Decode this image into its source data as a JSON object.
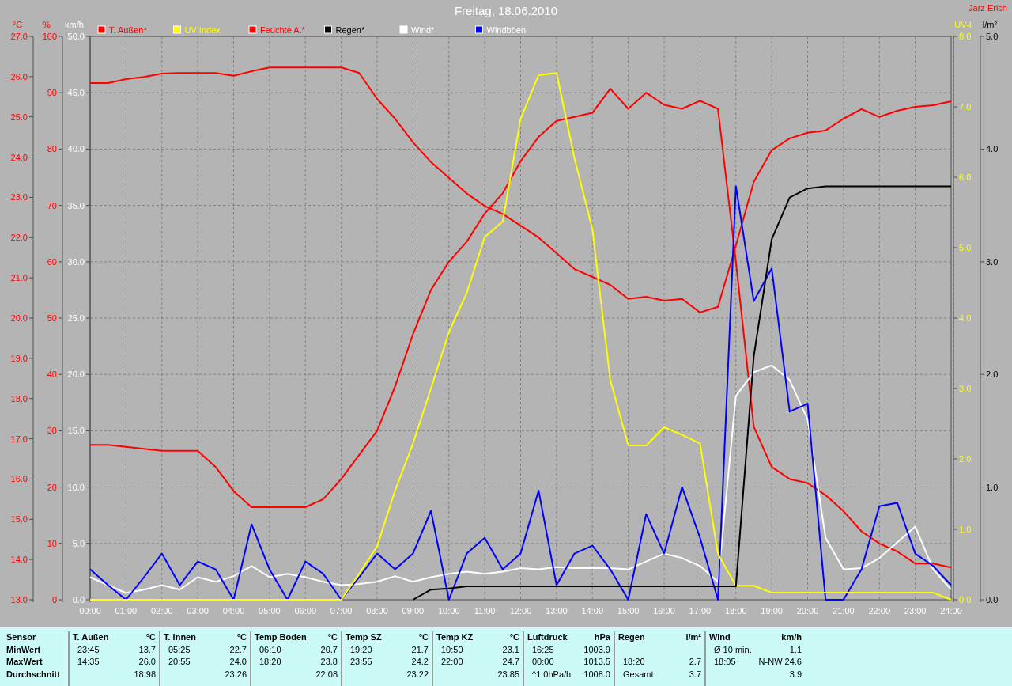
{
  "chart": {
    "author": "Jarz Erich",
    "left_scale": {
      "chart_data": {
        "type": "line",
        "title": "Freitag, 18.06.2010",
        "legend": "top",
        "grid": true,
        "x": [
          0,
          0.5,
          1,
          1.5,
          2,
          2.5,
          3,
          3.5,
          4,
          4.5,
          5,
          5.5,
          6,
          6.5,
          7,
          7.5,
          8,
          8.5,
          9,
          9.5,
          10,
          10.5,
          11,
          11.5,
          12,
          12.5,
          13,
          13.5,
          14,
          14.5,
          15,
          15.5,
          16,
          16.5,
          17,
          17.5,
          18,
          18.5,
          19,
          19.5,
          20,
          20.5,
          21,
          21.5,
          22,
          22.5,
          23,
          23.5,
          24
        ],
        "xlim": [
          0,
          24
        ],
        "xticks": [
          {
            "value": 0,
            "label": "00:00"
          },
          {
            "value": 1,
            "label": "01:00"
          },
          {
            "value": 2,
            "label": "02:00"
          },
          {
            "value": 3,
            "label": "03:00"
          },
          {
            "value": 4,
            "label": "04:00"
          },
          {
            "value": 5,
            "label": "05:00"
          },
          {
            "value": 6,
            "label": "06:00"
          },
          {
            "value": 7,
            "label": "07:00"
          },
          {
            "value": 8,
            "label": "08:00"
          },
          {
            "value": 9,
            "label": "09:00"
          },
          {
            "value": 10,
            "label": "10:00"
          },
          {
            "value": 11,
            "label": "11:00"
          },
          {
            "value": 12,
            "label": "12:00"
          },
          {
            "value": 13,
            "label": "13:00"
          },
          {
            "value": 14,
            "label": "14:00"
          },
          {
            "value": 15,
            "label": "15:00"
          },
          {
            "value": 16,
            "label": "16:00"
          },
          {
            "value": 17,
            "label": "17:00"
          },
          {
            "value": 18,
            "label": "18:00"
          },
          {
            "value": 19,
            "label": "19:00"
          },
          {
            "value": 20,
            "label": "20:00"
          },
          {
            "value": 21,
            "label": "21:00"
          },
          {
            "value": 22,
            "label": "22:00"
          },
          {
            "value": 23,
            "label": "23:00"
          },
          {
            "value": 24,
            "label": "24:00"
          }
        ],
        "ylabel": "km/h",
        "ylim": [
          0,
          50
        ],
        "yticks": [
          {
            "value": 50,
            "label": "50.0"
          },
          {
            "value": 45,
            "label": "45.0"
          },
          {
            "value": 40,
            "label": "40.0"
          },
          {
            "value": 35,
            "label": "35.0"
          },
          {
            "value": 30,
            "label": "30.0"
          },
          {
            "value": 25,
            "label": "25.0"
          },
          {
            "value": 20,
            "label": "20.0"
          },
          {
            "value": 15,
            "label": "15.0"
          },
          {
            "value": 10,
            "label": "10.0"
          },
          {
            "value": 5,
            "label": "5.0"
          },
          {
            "value": 0,
            "label": "0.0"
          }
        ],
        "y2label": "°C",
        "y2lim": [
          13,
          27
        ],
        "y2ticks": [
          {
            "value": 27,
            "label": "27.0"
          },
          {
            "value": 26,
            "label": "26.0"
          },
          {
            "value": 25,
            "label": "25.0"
          },
          {
            "value": 24,
            "label": "24.0"
          },
          {
            "value": 23,
            "label": "23.0"
          },
          {
            "value": 22,
            "label": "22.0"
          },
          {
            "value": 21,
            "label": "21.0"
          },
          {
            "value": 20,
            "label": "20.0"
          },
          {
            "value": 19,
            "label": "19.0"
          },
          {
            "value": 18,
            "label": "18.0"
          },
          {
            "value": 17,
            "label": "17.0"
          },
          {
            "value": 16,
            "label": "16.0"
          },
          {
            "value": 15,
            "label": "15.0"
          },
          {
            "value": 14,
            "label": "14.0"
          },
          {
            "value": 13,
            "label": "13.0"
          }
        ],
        "y3label": "%",
        "y3lim": [
          0,
          100
        ],
        "y3ticks": [
          {
            "value": 100,
            "label": "100"
          },
          {
            "value": 90,
            "label": "90"
          },
          {
            "value": 80,
            "label": "80"
          },
          {
            "value": 70,
            "label": "70"
          },
          {
            "value": 60,
            "label": "60"
          },
          {
            "value": 50,
            "label": "50"
          },
          {
            "value": 40,
            "label": "40"
          },
          {
            "value": 30,
            "label": "30"
          },
          {
            "value": 20,
            "label": "20"
          },
          {
            "value": 10,
            "label": "10"
          },
          {
            "value": 0,
            "label": "0"
          }
        ],
        "series": [
          {
            "name": "T. Außen*",
            "color": "#ff0000",
            "axis": "y2",
            "values": [
              16.85,
              16.85,
              16.8,
              16.75,
              16.7,
              16.7,
              16.7,
              16.3,
              15.7,
              15.3,
              15.3,
              15.3,
              15.3,
              15.5,
              16.0,
              16.6,
              17.2,
              18.3,
              19.6,
              20.7,
              21.4,
              21.9,
              22.6,
              23.1,
              23.9,
              24.5,
              24.9,
              25.0,
              25.1,
              25.7,
              25.2,
              25.6,
              25.3,
              25.2,
              25.4,
              25.2,
              21.4,
              17.3,
              16.3,
              16.0,
              15.9,
              15.6,
              15.2,
              14.7,
              14.4,
              14.2,
              13.9,
              13.9,
              13.8
            ]
          },
          {
            "name": "Feuchte A.*",
            "color": "#ff0000",
            "axis": "y3",
            "values": [
              91.7,
              91.7,
              92.4,
              92.8,
              93.4,
              93.5,
              93.5,
              93.5,
              93.0,
              93.8,
              94.5,
              94.5,
              94.5,
              94.5,
              94.5,
              93.5,
              88.9,
              85.4,
              81.2,
              77.7,
              74.9,
              72.1,
              69.9,
              68.5,
              66.4,
              64.3,
              61.5,
              58.7,
              57.3,
              55.9,
              53.4,
              53.8,
              53.1,
              53.4,
              51.0,
              52.0,
              62.9,
              74.2,
              79.8,
              81.9,
              82.9,
              83.3,
              85.4,
              87.1,
              85.7,
              86.8,
              87.5,
              87.8,
              88.5
            ]
          },
          {
            "name": "Wind*",
            "color": "#ffffff",
            "values": [
              2.0,
              1.3,
              0.6,
              0.9,
              1.3,
              0.9,
              2.0,
              1.6,
              2.1,
              3.0,
              2.0,
              2.3,
              2.0,
              1.6,
              1.3,
              1.4,
              1.6,
              2.1,
              1.6,
              2.0,
              2.3,
              2.5,
              2.3,
              2.5,
              2.8,
              2.7,
              2.9,
              2.8,
              2.8,
              2.8,
              2.7,
              3.4,
              4.1,
              3.7,
              3.0,
              1.6,
              18.1,
              20.2,
              20.8,
              19.5,
              16.0,
              5.5,
              2.7,
              2.8,
              3.7,
              5.1,
              6.5,
              2.7,
              0.9
            ]
          },
          {
            "name": "Windböen",
            "color": "#0000ff",
            "values": [
              2.7,
              1.3,
              0,
              2.0,
              4.1,
              1.3,
              3.4,
              2.7,
              0,
              6.7,
              2.7,
              0,
              3.4,
              2.3,
              0,
              2.0,
              4.1,
              2.7,
              4.1,
              7.9,
              0,
              4.1,
              5.5,
              2.7,
              4.1,
              9.7,
              1.3,
              4.1,
              4.8,
              2.7,
              0,
              7.6,
              4.1,
              10.0,
              5.5,
              0,
              36.7,
              26.5,
              29.4,
              16.7,
              17.4,
              0,
              0,
              2.7,
              8.3,
              8.6,
              4.1,
              3.0,
              1.3
            ]
          }
        ]
      }
    },
    "right_scale": {
      "chart_data": {
        "type": "line",
        "legend": "top",
        "x": [
          0,
          0.5,
          1,
          1.5,
          2,
          2.5,
          3,
          3.5,
          4,
          4.5,
          5,
          5.5,
          6,
          6.5,
          7,
          7.5,
          8,
          8.5,
          9,
          9.5,
          10,
          10.5,
          11,
          11.5,
          12,
          12.5,
          13,
          13.5,
          14,
          14.5,
          15,
          15.5,
          16,
          16.5,
          17,
          17.5,
          18,
          18.5,
          19,
          19.5,
          20,
          20.5,
          21,
          21.5,
          22,
          22.5,
          23,
          23.5,
          24
        ],
        "xlim": [
          0,
          24
        ],
        "ylabel": "UV-I",
        "ylim": [
          0,
          8
        ],
        "yticks": [
          {
            "value": 8,
            "label": "8.0"
          },
          {
            "value": 7,
            "label": "7.0"
          },
          {
            "value": 6,
            "label": "6.0"
          },
          {
            "value": 5,
            "label": "5.0"
          },
          {
            "value": 4,
            "label": "4.0"
          },
          {
            "value": 3,
            "label": "3.0"
          },
          {
            "value": 2,
            "label": "2.0"
          },
          {
            "value": 1,
            "label": "1.0"
          },
          {
            "value": 0,
            "label": "0.0"
          }
        ],
        "y2label": "l/m²",
        "y2lim": [
          0,
          5
        ],
        "y2ticks": [
          {
            "value": 5,
            "label": "5.0"
          },
          {
            "value": 4,
            "label": "4.0"
          },
          {
            "value": 3,
            "label": "3.0"
          },
          {
            "value": 2,
            "label": "2.0"
          },
          {
            "value": 1,
            "label": "1.0"
          },
          {
            "value": 0,
            "label": "0.0"
          }
        ],
        "series": [
          {
            "name": "UV Index",
            "color": "#ffff00",
            "values": [
              0,
              0,
              0,
              0,
              0,
              0,
              0,
              0,
              0,
              0,
              0,
              0,
              0,
              0,
              0,
              0.37,
              0.76,
              1.55,
              2.22,
              3.0,
              3.8,
              4.36,
              5.15,
              5.37,
              6.83,
              7.45,
              7.48,
              6.27,
              5.26,
              3.12,
              2.19,
              2.19,
              2.45,
              2.34,
              2.22,
              0.65,
              0.2,
              0.2,
              0.1,
              0.1,
              0.1,
              0.1,
              0.1,
              0.1,
              0.1,
              0.1,
              0.1,
              0.1,
              0
            ]
          },
          {
            "name": "Regen*",
            "color": "#000000",
            "axis": "y2",
            "values": [
              null,
              null,
              null,
              null,
              null,
              null,
              null,
              null,
              null,
              null,
              null,
              null,
              null,
              null,
              null,
              null,
              null,
              null,
              0,
              0.09,
              0.1,
              0.12,
              0.12,
              0.12,
              0.12,
              0.12,
              0.12,
              0.12,
              0.12,
              0.12,
              0.12,
              0.12,
              0.12,
              0.12,
              0.12,
              0.12,
              0.12,
              2.16,
              3.2,
              3.57,
              3.65,
              3.67,
              3.67,
              3.67,
              3.67,
              3.67,
              3.67,
              3.67,
              3.67
            ]
          }
        ]
      }
    }
  },
  "summary_table": {
    "header": "Sensor",
    "row_labels": [
      "MinWert",
      "MaxWert",
      "Durchschnitt"
    ],
    "groups": [
      {
        "name": "T. Außen",
        "unit": "°C",
        "cells": [
          {
            "time": "23:45",
            "value": "13.7"
          },
          {
            "time": "14:35",
            "value": "26.0"
          },
          {
            "value": "18.98"
          }
        ]
      },
      {
        "name": "T. Innen",
        "unit": "°C",
        "cells": [
          {
            "time": "05:25",
            "value": "22.7"
          },
          {
            "time": "20:55",
            "value": "24.0"
          },
          {
            "value": "23.26"
          }
        ]
      },
      {
        "name": "Temp Boden",
        "unit": "°C",
        "cells": [
          {
            "time": "06:10",
            "value": "20.7"
          },
          {
            "time": "18:20",
            "value": "23.8"
          },
          {
            "value": "22.08"
          }
        ]
      },
      {
        "name": "Temp SZ",
        "unit": "°C",
        "cells": [
          {
            "time": "19:20",
            "value": "21.7"
          },
          {
            "time": "23:55",
            "value": "24.2"
          },
          {
            "value": "23.22"
          }
        ]
      },
      {
        "name": "Temp KZ",
        "unit": "°C",
        "cells": [
          {
            "time": "10:50",
            "value": "23.1"
          },
          {
            "time": "22:00",
            "value": "24.7"
          },
          {
            "value": "23.85"
          }
        ]
      },
      {
        "name": "Luftdruck",
        "unit": "hPa",
        "cells": [
          {
            "time": "16:25",
            "value": "1003.9"
          },
          {
            "time": "00:00",
            "value": "1013.5"
          },
          {
            "time": "^1.0hPa/h",
            "value": "1008.0"
          }
        ]
      },
      {
        "name": "Regen",
        "unit": "l/m²",
        "cells": [
          {},
          {
            "time": "18:20",
            "value": "2.7"
          },
          {
            "time": "Gesamt:",
            "value": "3.7"
          }
        ]
      },
      {
        "name": "Wind",
        "unit": "km/h",
        "cells": [
          {
            "time": "Ø 10 min.",
            "value": "1.1"
          },
          {
            "time": "18:05",
            "value": "N-NW 24.6"
          },
          {
            "value": "3.9"
          }
        ]
      }
    ]
  }
}
